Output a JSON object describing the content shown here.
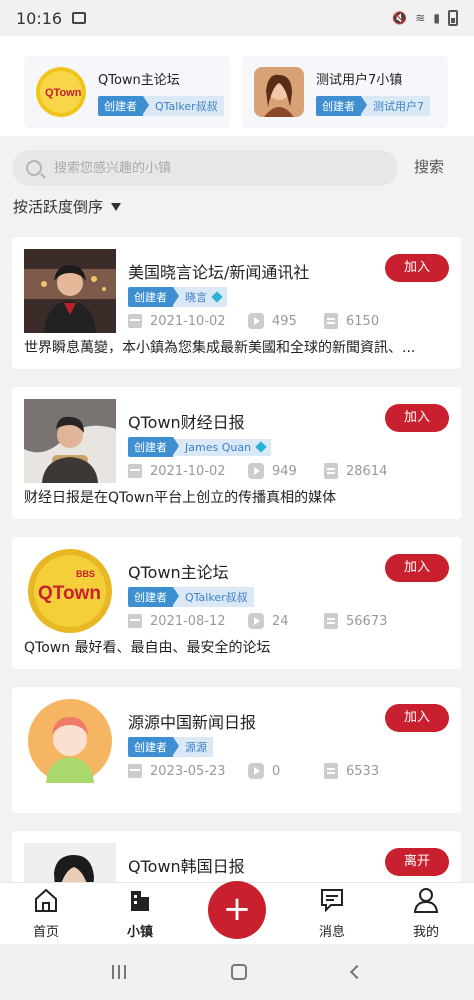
{
  "status_bar": {
    "time": "10:16"
  },
  "featured": [
    {
      "name": "QTown主论坛",
      "creator_label": "创建者",
      "creator": "QTalker叔叔"
    },
    {
      "name": "测试用户7小镇",
      "creator_label": "创建者",
      "creator": "测试用户7"
    }
  ],
  "search": {
    "placeholder": "搜索您感兴趣的小镇",
    "button": "搜索"
  },
  "sort": {
    "label": "按活跃度倒序"
  },
  "towns": [
    {
      "name": "美国晓言论坛/新闻通讯社",
      "creator_label": "创建者",
      "creator": "晓言",
      "date": "2021-10-02",
      "views": "495",
      "posts": "6150",
      "action": "加入",
      "desc": "世界瞬息萬變，本小鎮為您集成最新美國和全球的新聞資訊、..."
    },
    {
      "name": "QTown财经日报",
      "creator_label": "创建者",
      "creator": "James Quan",
      "date": "2021-10-02",
      "views": "949",
      "posts": "28614",
      "action": "加入",
      "desc": "财经日报是在QTown平台上创立的传播真相的媒体"
    },
    {
      "name": "QTown主论坛",
      "creator_label": "创建者",
      "creator": "QTalker叔叔",
      "date": "2021-08-12",
      "views": "24",
      "posts": "56673",
      "action": "加入",
      "desc": "QTown 最好看、最自由、最安全的论坛"
    },
    {
      "name": "源源中国新闻日报",
      "creator_label": "创建者",
      "creator": "源源",
      "date": "2023-05-23",
      "views": "0",
      "posts": "6533",
      "action": "加入",
      "desc": ""
    },
    {
      "name": "QTown韩国日报",
      "action": "离开"
    }
  ],
  "bottom_nav": [
    {
      "label": "首页",
      "icon": "home-icon"
    },
    {
      "label": "小镇",
      "icon": "building-icon"
    },
    {
      "label": "+",
      "icon": "plus-icon"
    },
    {
      "label": "消息",
      "icon": "message-icon"
    },
    {
      "label": "我的",
      "icon": "user-icon"
    }
  ],
  "colors": {
    "accent": "#c8202e",
    "tag_blue": "#3d8fd1",
    "tag_light": "#dbe9f7"
  }
}
